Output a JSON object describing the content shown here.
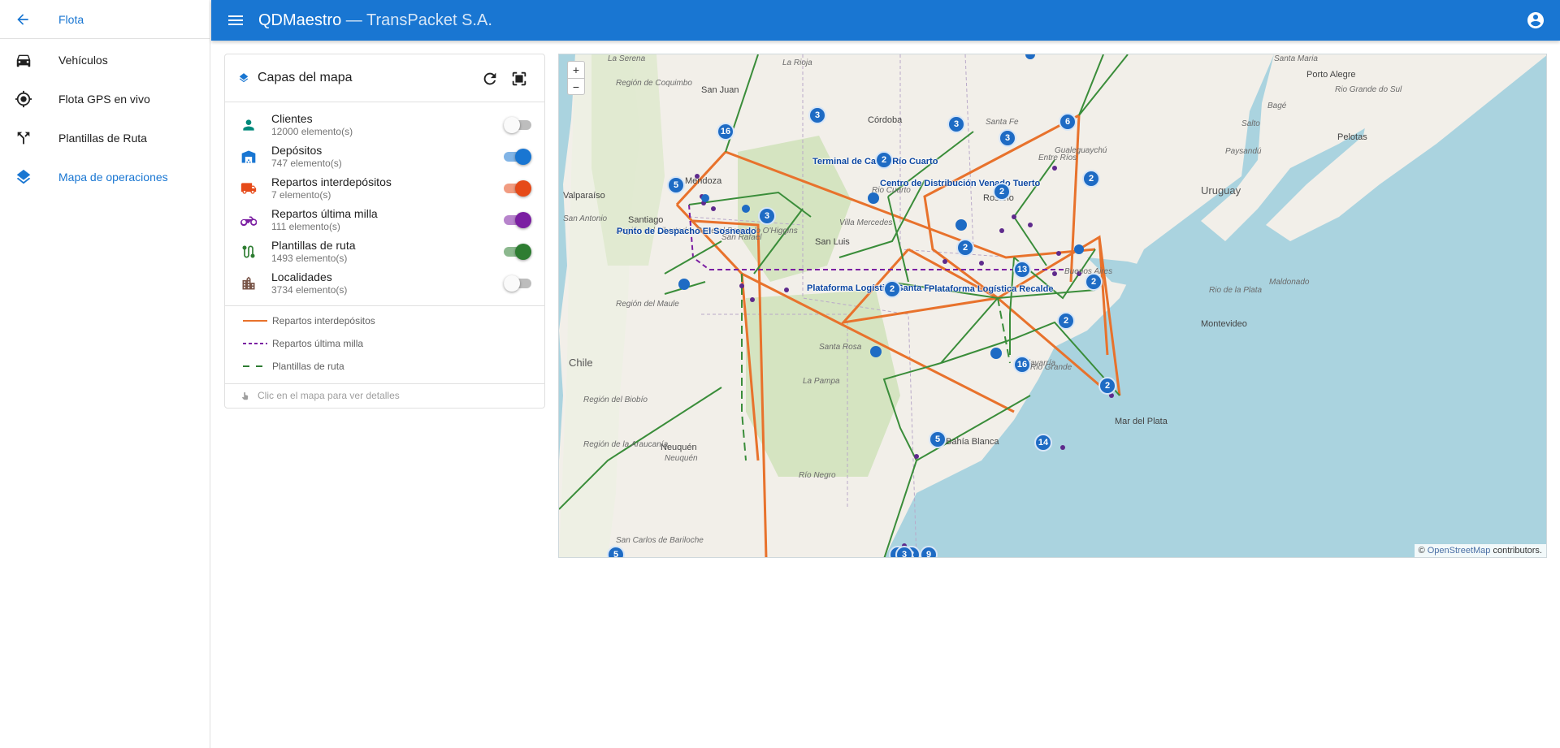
{
  "sidebar": {
    "back_label": "Flota",
    "items": [
      {
        "label": "Vehículos",
        "icon": "car-icon"
      },
      {
        "label": "Flota GPS en vivo",
        "icon": "gps-icon"
      },
      {
        "label": "Plantillas de Ruta",
        "icon": "fork-icon"
      },
      {
        "label": "Mapa de operaciones",
        "icon": "layers-icon",
        "active": true
      }
    ]
  },
  "appbar": {
    "title": "QDMaestro",
    "subtitle": " — TransPacket S.A.",
    "color": "#1976d2"
  },
  "layers_panel": {
    "title": "Capas del mapa",
    "layers": [
      {
        "name": "Clientes",
        "count": "12000 elemento(s)",
        "enabled": false,
        "color": "#00897b",
        "icon": "person-icon"
      },
      {
        "name": "Depósitos",
        "count": "747 elemento(s)",
        "enabled": true,
        "color": "#1976d2",
        "icon": "warehouse-icon"
      },
      {
        "name": "Repartos interdepósitos",
        "count": "7 elemento(s)",
        "enabled": true,
        "color": "#e64a19",
        "icon": "truck-icon"
      },
      {
        "name": "Repartos última milla",
        "count": "111 elemento(s)",
        "enabled": true,
        "color": "#7b1fa2",
        "icon": "motorcycle-icon"
      },
      {
        "name": "Plantillas de ruta",
        "count": "1493 elemento(s)",
        "enabled": true,
        "color": "#2e7d32",
        "icon": "route-icon"
      },
      {
        "name": "Localidades",
        "count": "3734 elemento(s)",
        "enabled": false,
        "color": "#795548",
        "icon": "city-icon"
      }
    ],
    "legend": [
      {
        "label": "Repartos interdepósitos",
        "color": "#e8722c",
        "style": "solid"
      },
      {
        "label": "Repartos última milla",
        "color": "#7b1fa2",
        "style": "dashed"
      },
      {
        "label": "Plantillas de ruta",
        "color": "#2e7d32",
        "style": "long-dashed"
      }
    ],
    "hint": "Clic en el mapa para ver detalles"
  },
  "map": {
    "zoom_in": "+",
    "zoom_out": "−",
    "attribution_prefix": "© ",
    "attribution_link": "OpenStreetMap",
    "attribution_suffix": " contributors.",
    "labels": [
      {
        "text": "Terminal de Carga Río Cuarto",
        "id": "terminal"
      },
      {
        "text": "Centro de Distribución Venado Tuerto",
        "id": "venado"
      },
      {
        "text": "Punto de Despacho El Sosneado",
        "id": "sosneado"
      },
      {
        "text": "Plataforma Logística Santa F",
        "id": "santafe"
      },
      {
        "text": "Plataforma Logística Recalde",
        "id": "recalde"
      }
    ],
    "places": {
      "big": [
        "Chile",
        "Uruguay"
      ],
      "cities": [
        "Córdoba",
        "Mendoza",
        "Santiago",
        "Rosario",
        "Montevideo",
        "Mar del Plata",
        "Bahía Blanca",
        "Neuquén",
        "San Juan",
        "San Luis",
        "Porto Alegre",
        "Pelotas",
        "Valparaíso"
      ],
      "small": [
        "La Serena",
        "La Rioja",
        "Santa Maria",
        "Región de Coquimbo",
        "Rio Grande do Sul",
        "Salto",
        "Paysandú",
        "Bagé",
        "Santa Fe",
        "Entre Ríos",
        "Gualeguaychú",
        "San Antonio",
        "Región del Libertador General Bernardo O'Higgins",
        "Villa Mercedes",
        "Rio Cuarto",
        "Región del Maule",
        "La Pampa",
        "Santa Rosa",
        "Buenos Aires",
        "Maldonado",
        "Rio de la Plata",
        "Región del Biobío",
        "Región de la Araucanía",
        "Río Negro",
        "San Carlos de Bariloche",
        "Neuquén",
        "Olavarría",
        "Rio Grande",
        "San Rafael"
      ]
    },
    "clusters": [
      "3",
      "2",
      "3",
      "3",
      "2",
      "2",
      "5",
      "2",
      "3",
      "2",
      "2",
      "6",
      "13",
      "2",
      "16",
      "2",
      "5",
      "14",
      "16",
      "3",
      "2",
      "3",
      "5",
      "9"
    ]
  }
}
